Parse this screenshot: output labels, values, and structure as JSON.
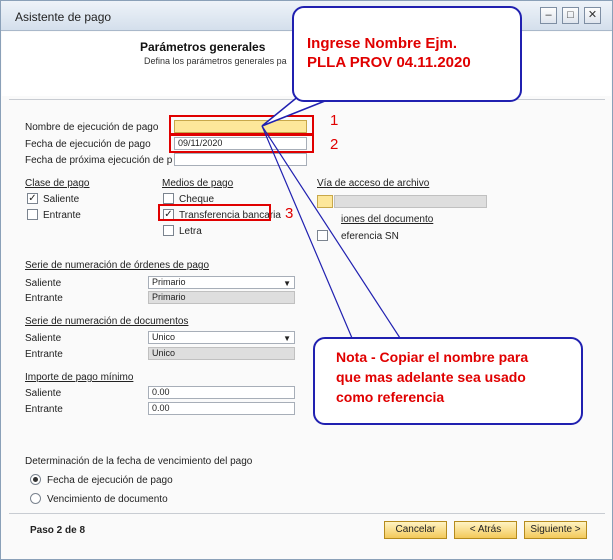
{
  "window": {
    "title": "Asistente de pago"
  },
  "header": {
    "title": "Parámetros generales",
    "subtitle": "Defina los parámetros generales pa"
  },
  "run": {
    "name_label": "Nombre de ejecución de pago",
    "name_value": "",
    "date_label": "Fecha de ejecución de pago",
    "date_value": "09/11/2020",
    "next_label": "Fecha de próxima ejecución de p",
    "next_value": ""
  },
  "payment_class": {
    "heading": "Clase de pago",
    "outgoing": "Saliente",
    "incoming": "Entrante"
  },
  "payment_means": {
    "heading": "Medios de pago",
    "cheque": "Cheque",
    "transfer": "Transferencia bancaria",
    "bill": "Letra"
  },
  "file_access": {
    "heading": "Vía de acceso de archivo",
    "doc_options": "iones del documento",
    "bp_reference": "eferencia SN"
  },
  "order_series": {
    "heading": "Serie de numeración de órdenes de pago",
    "outgoing_label": "Saliente",
    "outgoing_value": "Primario",
    "incoming_label": "Entrante",
    "incoming_value": "Primario"
  },
  "doc_series": {
    "heading": "Serie de numeración de documentos",
    "outgoing_label": "Saliente",
    "outgoing_value": "Unico",
    "incoming_label": "Entrante",
    "incoming_value": "Unico"
  },
  "min_amount": {
    "heading": "Importe de pago mínimo",
    "outgoing_label": "Saliente",
    "outgoing_value": "0.00",
    "incoming_label": "Entrante",
    "incoming_value": "0.00"
  },
  "due_date": {
    "heading": "Determinación de la fecha de vencimiento del pago",
    "option_run_date": "Fecha de ejecución de pago",
    "option_doc_due": "Vencimiento de documento"
  },
  "footer": {
    "step": "Paso 2 de 8",
    "cancel": "Cancelar",
    "back": "< Atrás",
    "next": "Siguiente >"
  },
  "annotations": {
    "num1": "1",
    "num2": "2",
    "num3": "3",
    "callout_top_line1": "Ingrese Nombre Ejm.",
    "callout_top_line2": "PLLA PROV 04.11.2020",
    "callout_note_line1": "Nota - Copiar el nombre para",
    "callout_note_line2": "que mas adelante sea usado",
    "callout_note_line3": "como referencia"
  },
  "colors": {
    "annotation_red": "#e00000",
    "callout_border": "#2020b0",
    "required_field": "#fde79a",
    "button_gold": "#f3c95a"
  }
}
